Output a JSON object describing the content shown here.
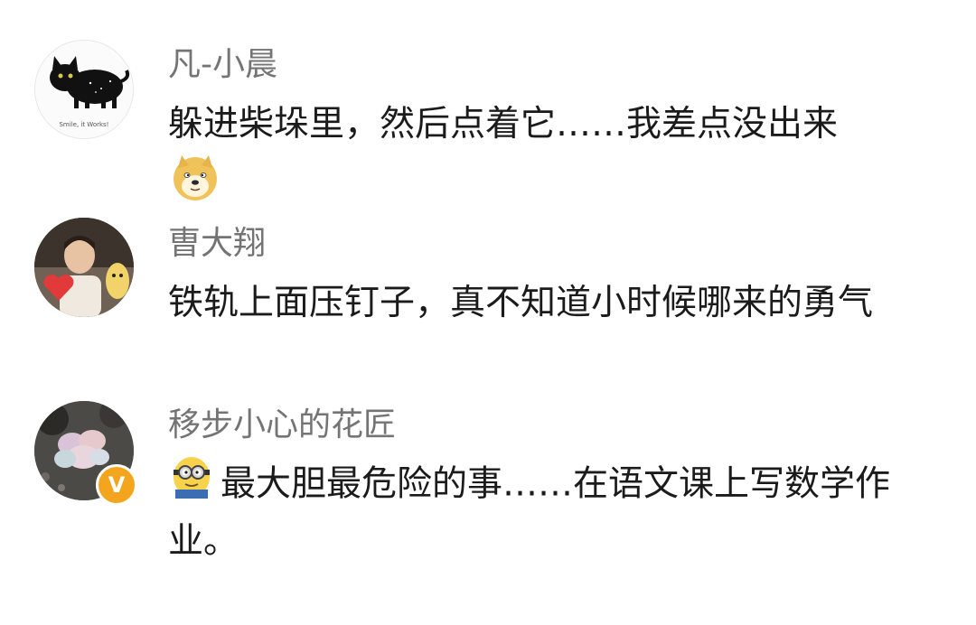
{
  "comments": [
    {
      "username": "凡-小晨",
      "text": "躲进柴垛里，然后点着它……我差点没出来",
      "avatar_icon": "black-cat-avatar",
      "avatar_caption": "Smile, it Works!",
      "emoji": "doge-emoji"
    },
    {
      "username": "曺大翔",
      "text": "铁轨上面压钉子，真不知道小时候哪来的勇气",
      "avatar_icon": "person-with-heart-avatar"
    },
    {
      "username": "移步小心的花匠",
      "text": "最大胆最危险的事……在语文课上写数学作业。",
      "avatar_icon": "succulent-plant-avatar",
      "verified_badge": "V",
      "emoji": "minion-emoji"
    }
  ],
  "colors": {
    "username": "#747474",
    "text": "#1b1b1b",
    "badge": "#f3a61d"
  }
}
